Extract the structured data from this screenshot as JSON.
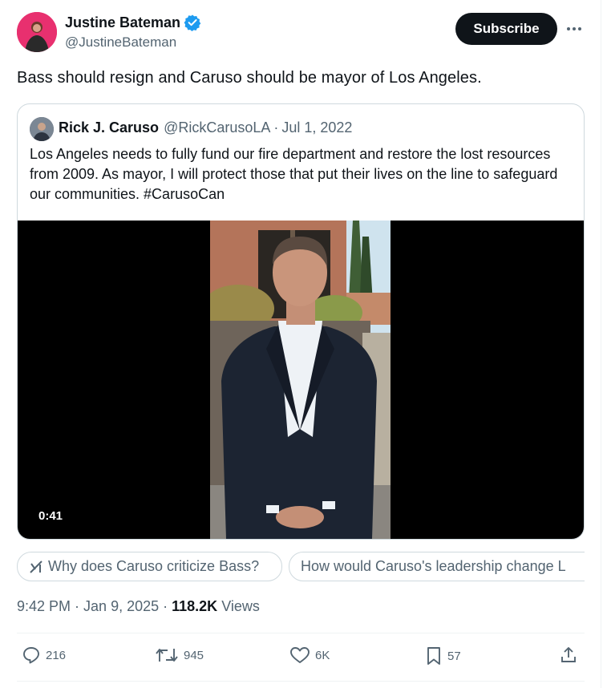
{
  "author": {
    "display_name": "Justine Bateman",
    "handle": "@JustineBateman",
    "verified": true
  },
  "subscribe_label": "Subscribe",
  "tweet_text": "Bass should resign and Caruso should be mayor of Los Angeles.",
  "quote": {
    "display_name": "Rick J. Caruso",
    "handle": "@RickCarusoLA",
    "separator": "·",
    "date": "Jul 1, 2022",
    "text": "Los Angeles needs to fully fund our fire department and restore the lost resources from 2009. As mayor, I will protect those that put their lives on the line to safeguard our communities. #CarusoCan",
    "video_duration": "0:41"
  },
  "grok_chips": [
    {
      "label": "Why does Caruso criticize Bass?"
    },
    {
      "label": "How would Caruso's leadership change L"
    }
  ],
  "meta": {
    "time": "9:42 PM",
    "sep1": " · ",
    "date": "Jan 9, 2025",
    "sep2": " · ",
    "views_count": "118.2K",
    "views_label": " Views"
  },
  "actions": {
    "replies": "216",
    "reposts": "945",
    "likes": "6K",
    "bookmarks": "57"
  },
  "colors": {
    "verified_blue": "#1d9bf0",
    "text_primary": "#0f1419",
    "text_secondary": "#536471",
    "border": "#cfd9de"
  },
  "icons": {
    "verified": "verified-badge-icon",
    "more": "more-dots-icon",
    "grok": "grok-icon",
    "reply": "reply-icon",
    "repost": "repost-icon",
    "like": "heart-icon",
    "bookmark": "bookmark-icon",
    "share": "share-icon"
  }
}
